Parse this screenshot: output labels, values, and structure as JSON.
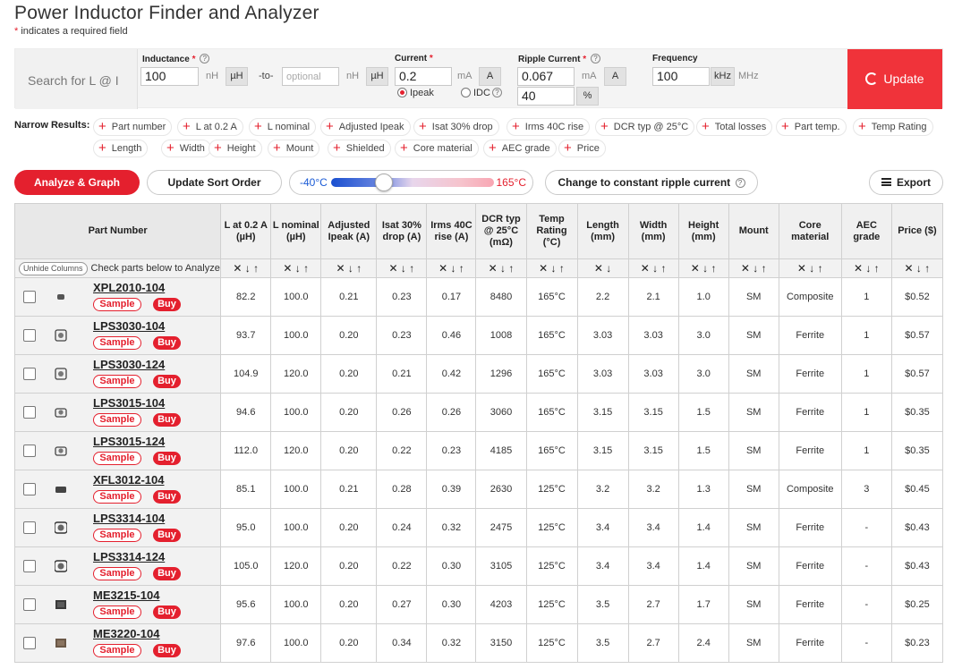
{
  "page": {
    "title": "Power Inductor Finder and Analyzer",
    "required_note": "* indicates a required field"
  },
  "search": {
    "placeholder": "Search for L @ I",
    "inductance": {
      "label": "Inductance",
      "value": "100",
      "unit_nh": "nH",
      "unit_uh": "µH",
      "to_text": "-to-",
      "optional_placeholder": "optional",
      "unit_nh2": "nH",
      "unit_uh2": "µH"
    },
    "current": {
      "label": "Current",
      "value": "0.2",
      "unit_ma": "mA",
      "unit_a": "A",
      "radio_ipeak": "Ipeak",
      "radio_idc": "IDC",
      "selected": "Ipeak"
    },
    "ripple": {
      "label": "Ripple Current",
      "value": "0.067",
      "unit_ma": "mA",
      "unit_a": "A",
      "percent_value": "40",
      "percent_unit": "%"
    },
    "frequency": {
      "label": "Frequency",
      "value": "100",
      "unit_khz": "kHz",
      "unit_mhz": "MHz"
    },
    "update_label": "Update"
  },
  "narrow": {
    "label": "Narrow Results:",
    "chips": [
      "Part number",
      "L at 0.2 A",
      "L nominal",
      "Adjusted Ipeak",
      "Isat 30% drop",
      "Irms 40C rise",
      "DCR typ @ 25°C",
      "Total losses",
      "Part temp.",
      "Temp Rating",
      "Length",
      "Width",
      "Height",
      "Mount",
      "Shielded",
      "Core material",
      "AEC grade",
      "Price"
    ]
  },
  "toolbar": {
    "analyze_label": "Analyze & Graph",
    "sort_label": "Update Sort Order",
    "temp_low": "-40°C",
    "temp_high": "165°C",
    "ripple_mode_label": "Change to constant ripple current",
    "export_label": "Export"
  },
  "table": {
    "part_number_header": "Part Number",
    "unhide_label": "Unhide Columns",
    "check_text": "Check parts below to Analyze",
    "sample_label": "Sample",
    "buy_label": "Buy",
    "columns": [
      {
        "label": "L at 0.2 A (µH)",
        "sorts": "✕ ↓ ↑"
      },
      {
        "label": "L nominal (µH)",
        "sorts": "✕ ↓ ↑"
      },
      {
        "label": "Adjusted Ipeak (A)",
        "sorts": "✕ ↓ ↑"
      },
      {
        "label": "Isat 30% drop (A)",
        "sorts": "✕ ↓ ↑"
      },
      {
        "label": "Irms 40C rise (A)",
        "sorts": "✕ ↓ ↑"
      },
      {
        "label": "DCR typ @ 25°C (mΩ)",
        "sorts": "✕ ↓ ↑"
      },
      {
        "label": "Temp Rating (°C)",
        "sorts": "✕ ↓ ↑"
      },
      {
        "label": "Length (mm)",
        "sorts": "✕ ↓"
      },
      {
        "label": "Width (mm)",
        "sorts": "✕ ↓ ↑"
      },
      {
        "label": "Height (mm)",
        "sorts": "✕ ↓ ↑"
      },
      {
        "label": "Mount",
        "sorts": "✕ ↓ ↑"
      },
      {
        "label": "Core material",
        "sorts": "✕ ↓ ↑"
      },
      {
        "label": "AEC grade",
        "sorts": "✕ ↓ ↑"
      },
      {
        "label": "Price ($)",
        "sorts": "✕ ↓ ↑"
      }
    ],
    "rows": [
      {
        "part": "XPL2010-104",
        "icon": "composite-small",
        "values": [
          "82.2",
          "100.0",
          "0.21",
          "0.23",
          "0.17",
          "8480",
          "165°C",
          "2.2",
          "2.1",
          "1.0",
          "SM",
          "Composite",
          "1",
          "$0.52"
        ]
      },
      {
        "part": "LPS3030-104",
        "icon": "ferrite-cube",
        "values": [
          "93.7",
          "100.0",
          "0.20",
          "0.23",
          "0.46",
          "1008",
          "165°C",
          "3.03",
          "3.03",
          "3.0",
          "SM",
          "Ferrite",
          "1",
          "$0.57"
        ]
      },
      {
        "part": "LPS3030-124",
        "icon": "ferrite-cube",
        "values": [
          "104.9",
          "120.0",
          "0.20",
          "0.21",
          "0.42",
          "1296",
          "165°C",
          "3.03",
          "3.03",
          "3.0",
          "SM",
          "Ferrite",
          "1",
          "$0.57"
        ]
      },
      {
        "part": "LPS3015-104",
        "icon": "ferrite-low",
        "values": [
          "94.6",
          "100.0",
          "0.20",
          "0.26",
          "0.26",
          "3060",
          "165°C",
          "3.15",
          "3.15",
          "1.5",
          "SM",
          "Ferrite",
          "1",
          "$0.35"
        ]
      },
      {
        "part": "LPS3015-124",
        "icon": "ferrite-low",
        "values": [
          "112.0",
          "120.0",
          "0.20",
          "0.22",
          "0.23",
          "4185",
          "165°C",
          "3.15",
          "3.15",
          "1.5",
          "SM",
          "Ferrite",
          "1",
          "$0.35"
        ]
      },
      {
        "part": "XFL3012-104",
        "icon": "composite-flat",
        "values": [
          "85.1",
          "100.0",
          "0.21",
          "0.28",
          "0.39",
          "2630",
          "125°C",
          "3.2",
          "3.2",
          "1.3",
          "SM",
          "Composite",
          "3",
          "$0.45"
        ]
      },
      {
        "part": "LPS3314-104",
        "icon": "ferrite-wide",
        "values": [
          "95.0",
          "100.0",
          "0.20",
          "0.24",
          "0.32",
          "2475",
          "125°C",
          "3.4",
          "3.4",
          "1.4",
          "SM",
          "Ferrite",
          "-",
          "$0.43"
        ]
      },
      {
        "part": "LPS3314-124",
        "icon": "ferrite-wide",
        "values": [
          "105.0",
          "120.0",
          "0.20",
          "0.22",
          "0.30",
          "3105",
          "125°C",
          "3.4",
          "3.4",
          "1.4",
          "SM",
          "Ferrite",
          "-",
          "$0.43"
        ]
      },
      {
        "part": "ME3215-104",
        "icon": "me-dark",
        "values": [
          "95.6",
          "100.0",
          "0.20",
          "0.27",
          "0.30",
          "4203",
          "125°C",
          "3.5",
          "2.7",
          "1.7",
          "SM",
          "Ferrite",
          "-",
          "$0.25"
        ]
      },
      {
        "part": "ME3220-104",
        "icon": "me-brown",
        "values": [
          "97.6",
          "100.0",
          "0.20",
          "0.34",
          "0.32",
          "3150",
          "125°C",
          "3.5",
          "2.7",
          "2.4",
          "SM",
          "Ferrite",
          "-",
          "$0.23"
        ]
      }
    ]
  }
}
